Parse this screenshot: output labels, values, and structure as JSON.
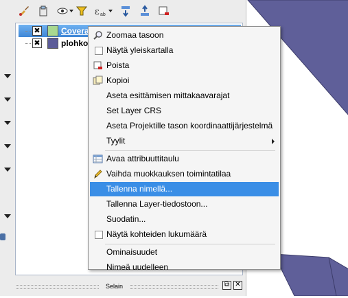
{
  "layers_panel": {
    "layers": [
      {
        "name": "Coveral",
        "checked": true,
        "color": "#a8d890",
        "selected": true
      },
      {
        "name": "plohko_",
        "checked": true,
        "color": "#5c5c99",
        "selected": false
      }
    ],
    "check_mark": "✖",
    "bottom_title": "Selain"
  },
  "map": {
    "polygon_color": "#5f5f99"
  },
  "context_menu": {
    "items": [
      {
        "label": "Zoomaa tasoon",
        "icon": "zoom-icon"
      },
      {
        "label": "Näytä yleiskartalla",
        "checkbox": true,
        "checked": false
      },
      {
        "label": "Poista",
        "icon": "remove-layer-icon"
      },
      {
        "label": "Kopioi",
        "icon": "duplicate-icon"
      },
      {
        "label": "Aseta esittämisen mittakaavarajat"
      },
      {
        "label": "Set Layer CRS"
      },
      {
        "label": "Aseta Projektille tason koordinaattijärjestelmä"
      },
      {
        "label": "Tyylit",
        "submenu": true
      },
      {
        "label": "Avaa attribuuttitaulu",
        "icon": "attribute-table-icon"
      },
      {
        "label": "Vaihda muokkauksen toimintatilaa",
        "icon": "pencil-icon"
      },
      {
        "label": "Tallenna nimellä...",
        "highlighted": true
      },
      {
        "label": "Tallenna Layer-tiedostoon..."
      },
      {
        "label": "Suodatin..."
      },
      {
        "label": "Näytä kohteiden lukumäärä",
        "checkbox": true,
        "checked": false
      },
      {
        "label": "Ominaisuudet"
      },
      {
        "label": "Nimeä uudelleen"
      }
    ]
  }
}
